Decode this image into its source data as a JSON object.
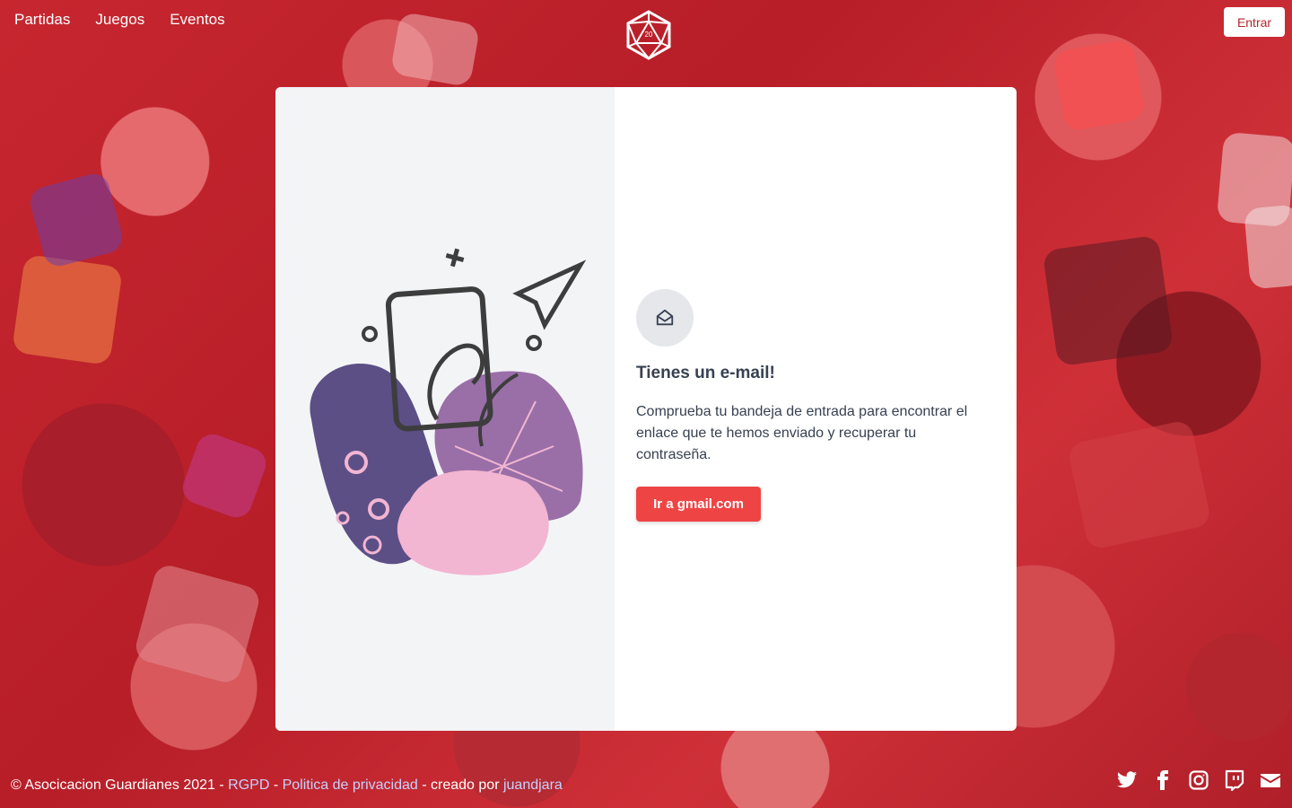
{
  "nav": {
    "items": [
      {
        "label": "Partidas"
      },
      {
        "label": "Juegos"
      },
      {
        "label": "Eventos"
      }
    ],
    "login_label": "Entrar",
    "logo_text": "20"
  },
  "card": {
    "title": "Tienes un e-mail!",
    "description": "Comprueba tu bandeja de entrada para encontrar el enlace que te hemos enviado y recuperar tu contraseña.",
    "cta_label": "Ir a gmail.com",
    "icon": "envelope-open-icon"
  },
  "footer": {
    "copyright": "© Asocicacion Guardianes 2021 - ",
    "rgpd": "RGPD",
    "sep1": " - ",
    "privacy": "Politica de privacidad",
    "created_by": " - creado por ",
    "author": "juandjara"
  },
  "social": [
    "twitter-icon",
    "facebook-icon",
    "instagram-icon",
    "twitch-icon",
    "mail-icon"
  ],
  "colors": {
    "accent": "#ef4444",
    "background": "#c4222b",
    "link": "#c7d2fe"
  }
}
